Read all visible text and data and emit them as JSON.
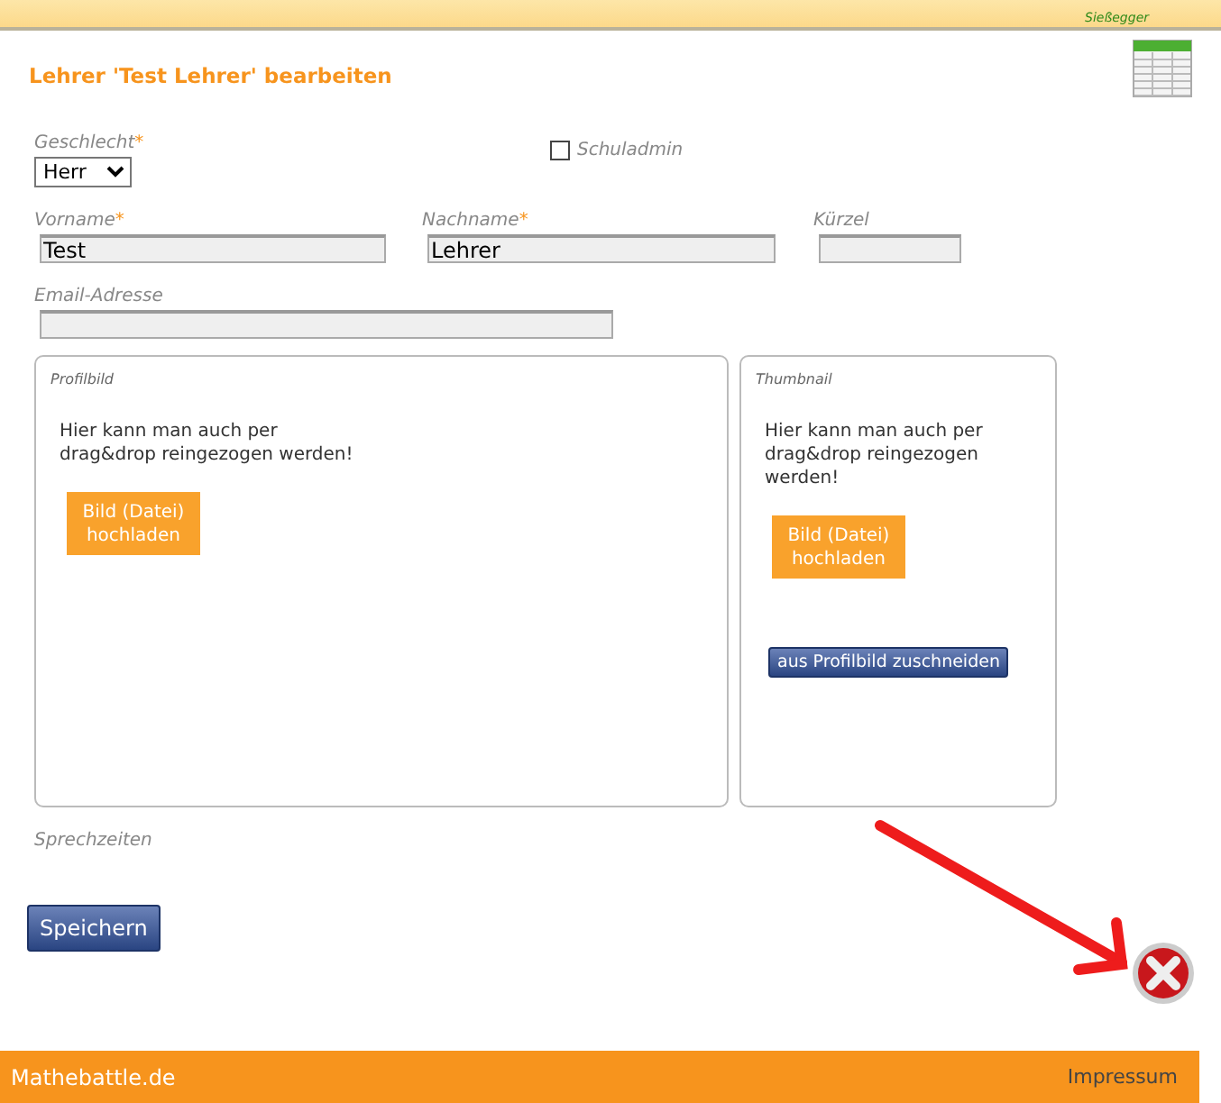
{
  "header": {
    "user": "Sießegger"
  },
  "title": "Lehrer 'Test Lehrer' bearbeiten",
  "gender": {
    "label": "Geschlecht",
    "mark": "*",
    "value": "Herr"
  },
  "schuladmin": {
    "label": "Schuladmin",
    "checked": false
  },
  "fields": [
    {
      "label": "Vorname",
      "mark": "*",
      "value": "Test"
    },
    {
      "label": "Nachname",
      "mark": "*",
      "value": "Lehrer"
    },
    {
      "label": "Kürzel"
    }
  ],
  "email": {
    "label": "Email-Adresse"
  },
  "panels": [
    {
      "kind": "profile",
      "title": "Profilbild",
      "hint": "Hier kann man auch per drag&drop reingezogen werden!",
      "upload_button": "Bild (Datei) hochladen"
    },
    {
      "kind": "thumbnail",
      "title": "Thumbnail",
      "hint": "Hier kann man auch per drag&drop reingezogen werden!",
      "upload_button": "Bild (Datei) hochladen",
      "crop_button": "aus Profilbild zuschneiden"
    }
  ],
  "sprechzeiten": "Sprechzeiten",
  "save_button": "Speichern",
  "footer": {
    "brand": "Mathebattle.de",
    "link": "Impressum"
  }
}
